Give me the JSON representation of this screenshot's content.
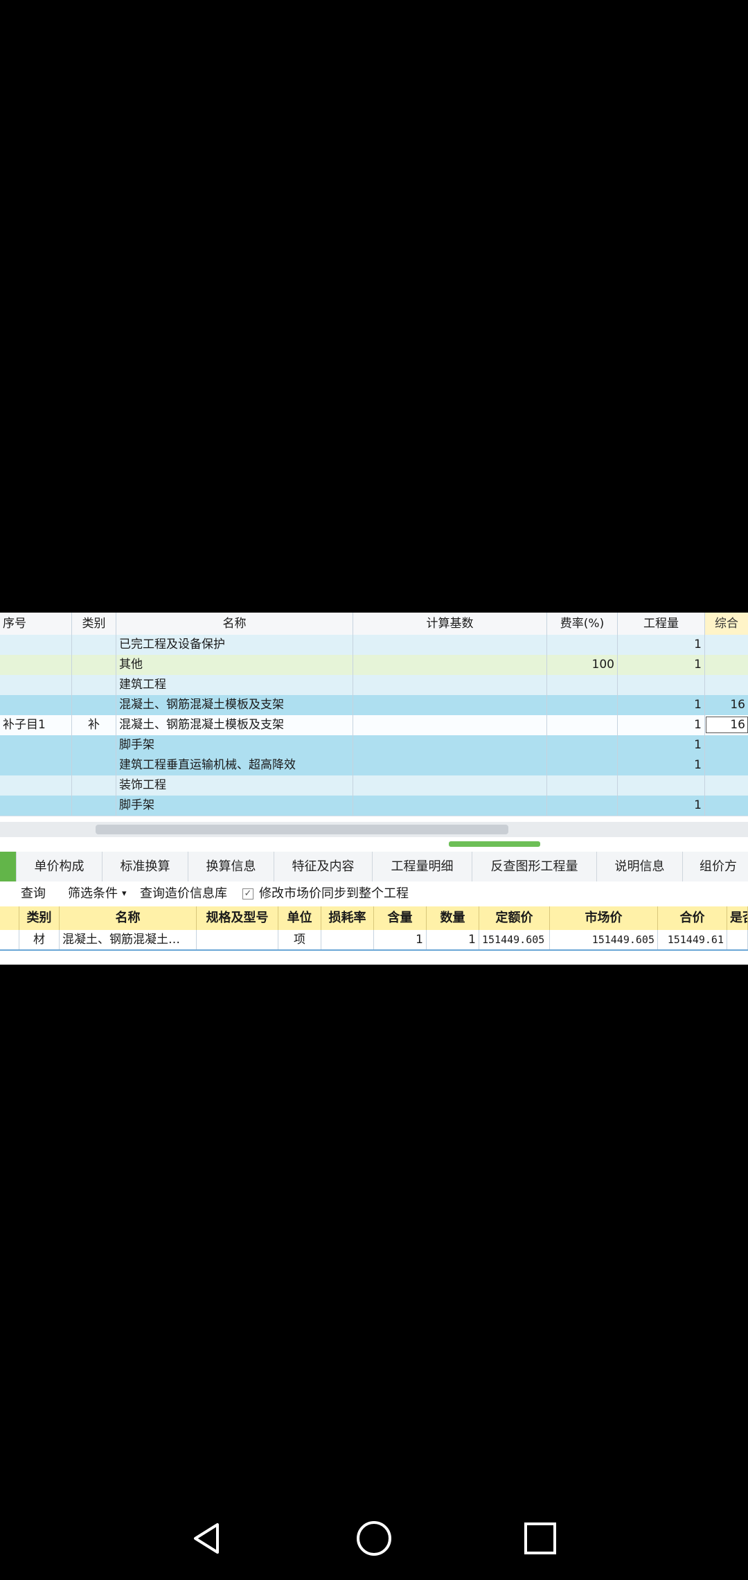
{
  "upper_table": {
    "headers": {
      "seq": "序号",
      "category": "类别",
      "name": "名称",
      "calc_base": "计算基数",
      "rate": "费率(%)",
      "quantity": "工程量",
      "composite": "综合"
    },
    "rows": [
      {
        "seq": "",
        "category": "",
        "name": "已完工程及设备保护",
        "calc_base": "",
        "rate": "",
        "quantity": "1",
        "composite": ""
      },
      {
        "seq": "",
        "category": "",
        "name": "其他",
        "calc_base": "",
        "rate": "100",
        "quantity": "1",
        "composite": ""
      },
      {
        "seq": "",
        "category": "",
        "name": "建筑工程",
        "calc_base": "",
        "rate": "",
        "quantity": "",
        "composite": ""
      },
      {
        "seq": "",
        "category": "",
        "name": "混凝土、钢筋混凝土模板及支架",
        "calc_base": "",
        "rate": "",
        "quantity": "1",
        "composite": "16"
      },
      {
        "seq": "补子目1",
        "category": "补",
        "name": "混凝土、钢筋混凝土模板及支架",
        "calc_base": "",
        "rate": "",
        "quantity": "1",
        "composite": "16"
      },
      {
        "seq": "",
        "category": "",
        "name": "脚手架",
        "calc_base": "",
        "rate": "",
        "quantity": "1",
        "composite": ""
      },
      {
        "seq": "",
        "category": "",
        "name": "建筑工程垂直运输机械、超高降效",
        "calc_base": "",
        "rate": "",
        "quantity": "1",
        "composite": ""
      },
      {
        "seq": "",
        "category": "",
        "name": "装饰工程",
        "calc_base": "",
        "rate": "",
        "quantity": "",
        "composite": ""
      },
      {
        "seq": "",
        "category": "",
        "name": "脚手架",
        "calc_base": "",
        "rate": "",
        "quantity": "1",
        "composite": ""
      }
    ]
  },
  "tabs": [
    "",
    "单价构成",
    "标准换算",
    "换算信息",
    "特征及内容",
    "工程量明细",
    "反查图形工程量",
    "说明信息",
    "组价方案"
  ],
  "toolbar": {
    "item0": "",
    "query": "查询",
    "filter": "筛选条件",
    "filter_arrow": "▾",
    "query_price_lib": "查询造价信息库",
    "sync_check": "✓",
    "sync_label": "修改市场价同步到整个工程"
  },
  "lower_table": {
    "headers": [
      "",
      "类别",
      "名称",
      "规格及型号",
      "单位",
      "损耗率",
      "含量",
      "数量",
      "定额价",
      "市场价",
      "合价",
      "是否"
    ],
    "row": [
      "",
      "材",
      "混凝土、钢筋混凝土…",
      "",
      "项",
      "",
      "1",
      "1",
      "151449.605",
      "151449.605",
      "151449.61",
      ""
    ]
  },
  "colors": {
    "row_blue": "#aedff0",
    "row_green": "#e6f4d8",
    "tab_active": "#62b549",
    "lower_header": "#fff1a8"
  },
  "nav": {
    "back": "back-icon",
    "home": "home-icon",
    "recents": "recents-icon"
  }
}
